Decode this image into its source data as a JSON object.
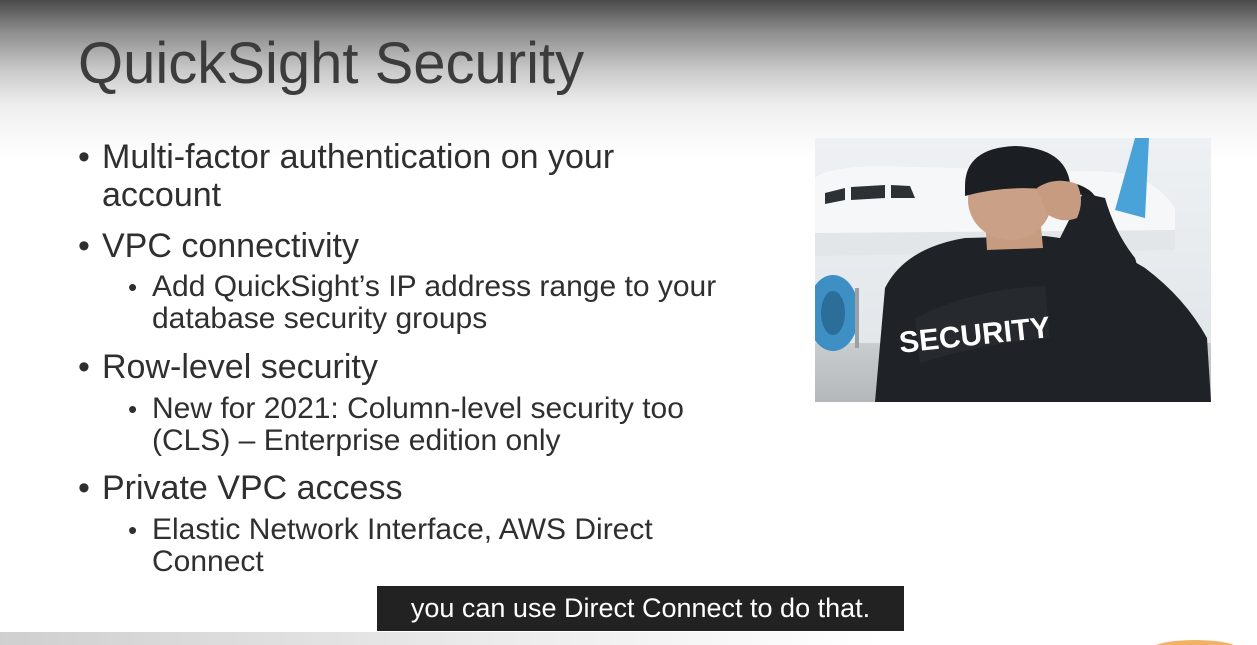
{
  "slide": {
    "title": "QuickSight Security",
    "bullets": [
      {
        "text": "Multi-factor authentication on your account",
        "sub": []
      },
      {
        "text": "VPC connectivity",
        "sub": [
          "Add QuickSight’s IP address range to your database security groups"
        ]
      },
      {
        "text": "Row-level security",
        "sub": [
          "New for 2021: Column-level security too (CLS) – Enterprise edition only"
        ]
      },
      {
        "text": "Private VPC access",
        "sub": [
          "Elastic Network Interface, AWS Direct Connect"
        ]
      }
    ],
    "photo": {
      "jacket_text": "SECURITY",
      "colors": {
        "sky": "#e9edf0",
        "jacket": "#1f2226",
        "plane_tail": "#4aa3d8"
      }
    }
  },
  "caption": {
    "text": "you can use Direct Connect to do that."
  },
  "colors": {
    "title": "#3c3c3c",
    "body_text": "#2f2f2f",
    "caption_bg": "#222222",
    "caption_text": "#ffffff"
  }
}
